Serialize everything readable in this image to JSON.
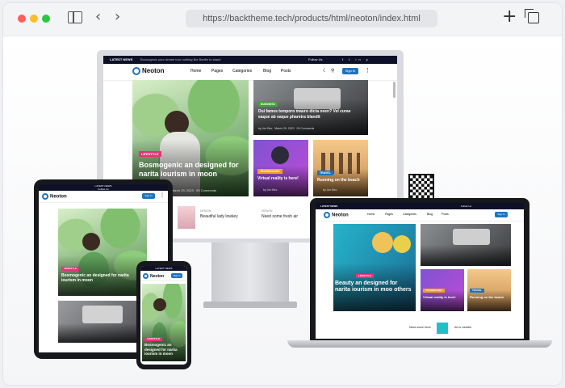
{
  "browser": {
    "url": "https://backtheme.tech/products/html/neoton/index.html",
    "colors": {
      "close": "#ff5f57",
      "minimize": "#febc2e",
      "maximize": "#28c840"
    },
    "icons": {
      "sidebar": "sidebar-icon",
      "back": "chevron-left-icon",
      "forward": "chevron-right-icon",
      "new_tab": "plus-icon",
      "tabs": "tabs-icon"
    }
  },
  "desktop": {
    "topbar": {
      "latest": "LATEST NEWS",
      "ticker": "Boosogenic your dream tour nothing like Baritin to stand",
      "follow": "Follow Us"
    },
    "logo": "Neoton",
    "nav": [
      "Home",
      "Pages",
      "Categories",
      "Blog",
      "Posts"
    ],
    "signin": "Sign In",
    "hero": {
      "badge": "LIFESTYLE",
      "title": "Bosmogenic an designed for narita iourism in moon",
      "date": "March 29, 2023",
      "comments": "09 Comments"
    },
    "card1": {
      "badge": "BUSINESS",
      "title": "Dui fames temporo mauro dicta oeen? Vel curae eaque ab eaque pharetra blandit",
      "author": "by Jon Bec",
      "date": "March 29, 2023",
      "comments": "09 Comments"
    },
    "card2": {
      "badge": "TECHNOLOGY",
      "title": "Virtual reality is here!",
      "author": "by Jon Bec"
    },
    "card3": {
      "badge": "TRAVEL",
      "title": "Running on the beach",
      "author": "by Jon Bec"
    },
    "row": [
      {
        "label": "DESIGN",
        "title": "Beautiful lady lowkey"
      },
      {
        "label": "DESIGN",
        "title": "Need some fresh air"
      }
    ]
  },
  "tablet": {
    "topbar": {
      "latest": "LATEST NEWS",
      "follow": "Follow Us"
    },
    "logo": "Neoton",
    "signin": "Sign In",
    "hero": {
      "badge": "LIFESTYLE",
      "title": "Bosmogenic an designed for narita iourism in moon"
    }
  },
  "phone": {
    "topbar": "LATEST NEWS",
    "logo": "Neoton",
    "signin": "Sign In",
    "hero": {
      "badge": "LIFESTYLE",
      "title": "Bosmogenic an designed for narita iourism in moon"
    }
  },
  "laptop": {
    "topbar": {
      "latest": "LATEST NEWS",
      "follow": "Follow Us"
    },
    "logo": "Neoton",
    "nav": [
      "Home",
      "Pages",
      "Categories",
      "Blog",
      "Posts"
    ],
    "signin": "Sign In",
    "hero": {
      "badge": "LIFESTYLE",
      "title": "Beauty an designed for narita iourism in moo others"
    },
    "card2": {
      "badge": "TECHNOLOGY",
      "title": "Virtual reality is here!"
    },
    "card3": {
      "badge": "TRAVEL",
      "title": "Running on the beach"
    },
    "row": [
      "Need some fresh",
      "Art is creative"
    ]
  }
}
